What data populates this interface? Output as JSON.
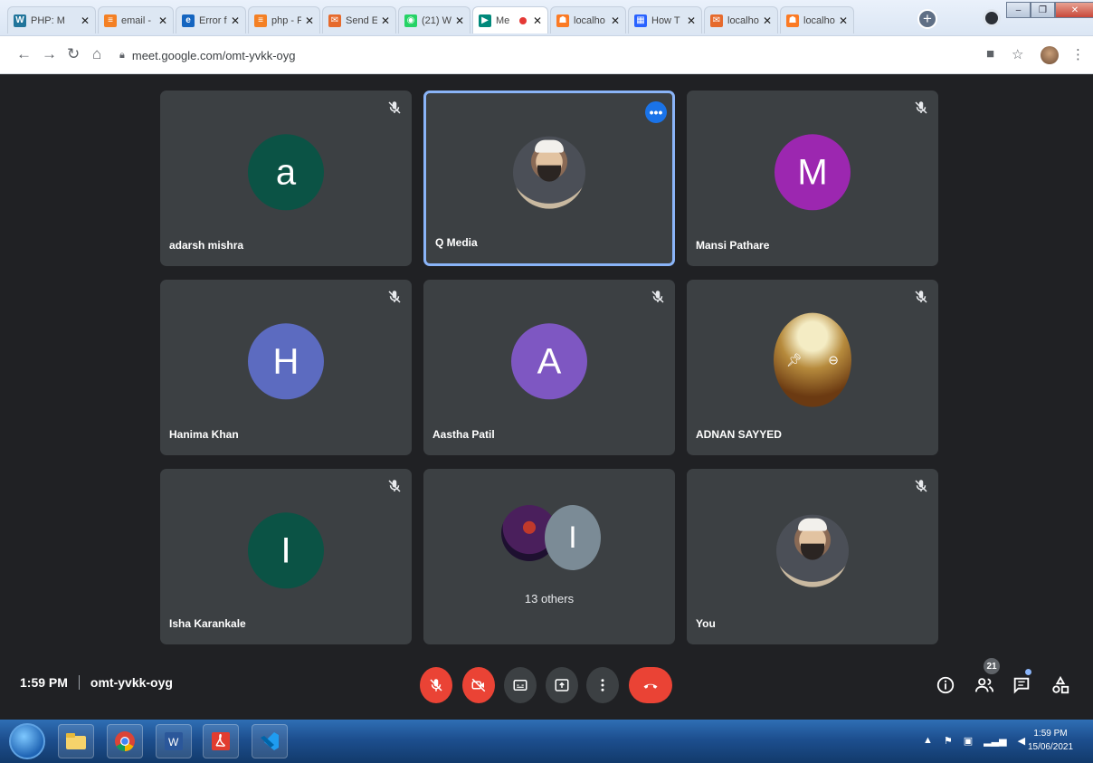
{
  "browser": {
    "tabs": [
      {
        "title": "PHP: M",
        "icon": "w-icon",
        "color": "#21759b",
        "glyph": "W"
      },
      {
        "title": "email -",
        "icon": "stackoverflow-icon",
        "color": "#f48024",
        "glyph": "≡"
      },
      {
        "title": "Error f",
        "icon": "e-icon",
        "color": "#1565c0",
        "glyph": "e"
      },
      {
        "title": "php - F",
        "icon": "stackoverflow-icon",
        "color": "#f48024",
        "glyph": "≡"
      },
      {
        "title": "Send E",
        "icon": "mail-icon",
        "color": "#e66a2c",
        "glyph": "✉"
      },
      {
        "title": "(21) W",
        "icon": "whatsapp-icon",
        "color": "#25d366",
        "glyph": "◉"
      },
      {
        "title": "Me",
        "icon": "meet-icon",
        "color": "#00897b",
        "glyph": "▶",
        "active": true,
        "recording": true
      },
      {
        "title": "localho",
        "icon": "xampp-icon",
        "color": "#fb7a24",
        "glyph": "☗"
      },
      {
        "title": "How T",
        "icon": "grid-icon",
        "color": "#2962ff",
        "glyph": "▦"
      },
      {
        "title": "localho",
        "icon": "mail-icon",
        "color": "#e66a2c",
        "glyph": "✉"
      },
      {
        "title": "localho",
        "icon": "xampp-icon",
        "color": "#fb7a24",
        "glyph": "☗"
      }
    ],
    "url": "meet.google.com/omt-yvkk-oyg"
  },
  "meeting": {
    "participants": [
      {
        "name": "adarsh mishra",
        "type": "letter",
        "letter": "a",
        "color": "#0b5345",
        "muted": true
      },
      {
        "name": "Q Media",
        "type": "photo",
        "speaking": true,
        "muted": false
      },
      {
        "name": "Mansi Pathare",
        "type": "letter",
        "letter": "M",
        "color": "#9c27b0",
        "muted": true
      },
      {
        "name": "Hanima Khan",
        "type": "letter",
        "letter": "H",
        "color": "#5c6bc0",
        "muted": true
      },
      {
        "name": "Aastha Patil",
        "type": "letter",
        "letter": "A",
        "color": "#7e57c2",
        "muted": true
      },
      {
        "name": "ADNAN SAYYED",
        "type": "art",
        "muted": true
      },
      {
        "name": "Isha Karankale",
        "type": "letter",
        "letter": "I",
        "color": "#0b5345",
        "muted": true
      },
      {
        "name": "",
        "type": "others",
        "others_label": "13 others",
        "second_letter": "I"
      },
      {
        "name": "You",
        "type": "photo",
        "muted": true
      }
    ],
    "time": "1:59 PM",
    "code": "omt-yvkk-oyg",
    "participant_count": "21"
  },
  "taskbar": {
    "time": "1:59 PM",
    "date": "15/06/2021"
  }
}
